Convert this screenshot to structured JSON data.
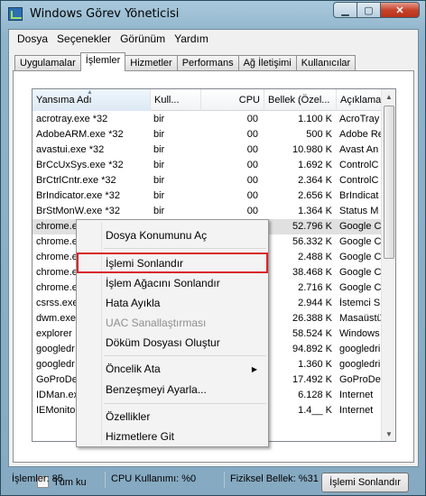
{
  "window": {
    "title": "Windows Görev Yöneticisi"
  },
  "menubar": [
    "Dosya",
    "Seçenekler",
    "Görünüm",
    "Yardım"
  ],
  "tabs": [
    "Uygulamalar",
    "İşlemler",
    "Hizmetler",
    "Performans",
    "Ağ İletişimi",
    "Kullanıcılar"
  ],
  "active_tab": "İşlemler",
  "columns": [
    "Yansıma Adı",
    "Kull...",
    "CPU",
    "Bellek (Özel...",
    "Açıklama"
  ],
  "rows": [
    {
      "name": "acrotray.exe *32",
      "user": "bir",
      "cpu": "00",
      "mem": "1.100 K",
      "desc": "AcroTray"
    },
    {
      "name": "AdobeARM.exe *32",
      "user": "bir",
      "cpu": "00",
      "mem": "500 K",
      "desc": "Adobe Re"
    },
    {
      "name": "avastui.exe *32",
      "user": "bir",
      "cpu": "00",
      "mem": "10.980 K",
      "desc": "Avast An"
    },
    {
      "name": "BrCcUxSys.exe *32",
      "user": "bir",
      "cpu": "00",
      "mem": "1.692 K",
      "desc": "ControlC"
    },
    {
      "name": "BrCtrlCntr.exe *32",
      "user": "bir",
      "cpu": "00",
      "mem": "2.364 K",
      "desc": "ControlC"
    },
    {
      "name": "BrIndicator.exe *32",
      "user": "bir",
      "cpu": "00",
      "mem": "2.656 K",
      "desc": "BrIndicat"
    },
    {
      "name": "BrStMonW.exe *32",
      "user": "bir",
      "cpu": "00",
      "mem": "1.364 K",
      "desc": "Status M"
    },
    {
      "name": "chrome.exe",
      "user": "bir",
      "cpu": "00",
      "mem": "52.796 K",
      "desc": "Google C"
    },
    {
      "name": "chrome.exe",
      "user": "",
      "cpu": "00",
      "mem": "56.332 K",
      "desc": "Google C"
    },
    {
      "name": "chrome.exe",
      "user": "",
      "cpu": "00",
      "mem": "2.488 K",
      "desc": "Google C"
    },
    {
      "name": "chrome.exe",
      "user": "",
      "cpu": "00",
      "mem": "38.468 K",
      "desc": "Google C"
    },
    {
      "name": "chrome.exe",
      "user": "",
      "cpu": "00",
      "mem": "2.716 K",
      "desc": "Google C"
    },
    {
      "name": "csrss.exe",
      "user": "",
      "cpu": "00",
      "mem": "2.944 K",
      "desc": "İstemci S"
    },
    {
      "name": "dwm.exe",
      "user": "",
      "cpu": "00",
      "mem": "26.388 K",
      "desc": "Masaüstü"
    },
    {
      "name": "explorer",
      "user": "",
      "cpu": "00",
      "mem": "58.524 K",
      "desc": "Windows"
    },
    {
      "name": "googledr",
      "user": "",
      "cpu": "00",
      "mem": "94.892 K",
      "desc": "googledri"
    },
    {
      "name": "googledr",
      "user": "",
      "cpu": "00",
      "mem": "1.360 K",
      "desc": "googledri"
    },
    {
      "name": "GoProDe",
      "user": "",
      "cpu": "00",
      "mem": "17.492 K",
      "desc": "GoProDes"
    },
    {
      "name": "IDMan.ex",
      "user": "",
      "cpu": "00",
      "mem": "6.128 K",
      "desc": "Internet"
    },
    {
      "name": "IEMonito",
      "user": "",
      "cpu": "00",
      "mem": "1.4__ K",
      "desc": "Internet"
    }
  ],
  "context_menu": {
    "open_location": "Dosya Konumunu Aç",
    "end_process": "İşlemi Sonlandır",
    "end_tree": "İşlem Ağacını Sonlandır",
    "debug": "Hata Ayıkla",
    "uac": "UAC Sanallaştırması",
    "dump": "Döküm Dosyası Oluştur",
    "priority": "Öncelik Ata",
    "affinity": "Benzeşmeyi Ayarla...",
    "properties": "Özellikler",
    "go_services": "Hizmetlere Git"
  },
  "footer": {
    "show_all": "Tüm ku",
    "end_button": "İşlemi Sonlandır"
  },
  "status": {
    "processes": "İşlemler: 85",
    "cpu": "CPU Kullanımı: %0",
    "memory": "Fiziksel Bellek: %31"
  },
  "colors": {
    "highlight_box": "#d9262b",
    "close_button": "#c7432c"
  }
}
